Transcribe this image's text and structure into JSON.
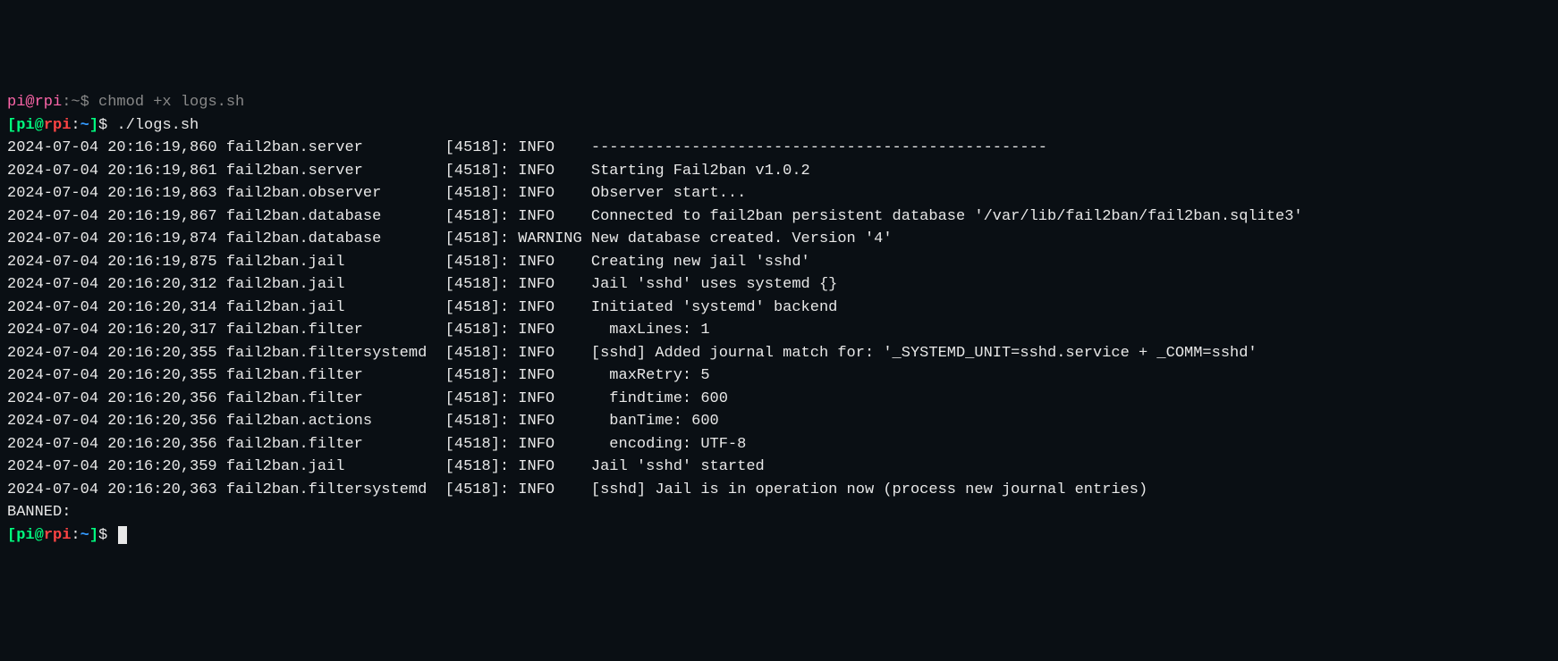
{
  "prompt": {
    "user": "pi",
    "at": "@",
    "host": "rpi",
    "path": "~",
    "dollar": "$",
    "open_bracket": "[",
    "close_bracket": "]",
    "colon": ":"
  },
  "top_partial": {
    "user_fragment": "pi@rpi",
    "rest": ":~$ chmod +x logs.sh"
  },
  "command": "./logs.sh",
  "logs": [
    "2024-07-04 20:16:19,860 fail2ban.server         [4518]: INFO    --------------------------------------------------",
    "2024-07-04 20:16:19,861 fail2ban.server         [4518]: INFO    Starting Fail2ban v1.0.2",
    "2024-07-04 20:16:19,863 fail2ban.observer       [4518]: INFO    Observer start...",
    "2024-07-04 20:16:19,867 fail2ban.database       [4518]: INFO    Connected to fail2ban persistent database '/var/lib/fail2ban/fail2ban.sqlite3'",
    "2024-07-04 20:16:19,874 fail2ban.database       [4518]: WARNING New database created. Version '4'",
    "2024-07-04 20:16:19,875 fail2ban.jail           [4518]: INFO    Creating new jail 'sshd'",
    "2024-07-04 20:16:20,312 fail2ban.jail           [4518]: INFO    Jail 'sshd' uses systemd {}",
    "2024-07-04 20:16:20,314 fail2ban.jail           [4518]: INFO    Initiated 'systemd' backend",
    "2024-07-04 20:16:20,317 fail2ban.filter         [4518]: INFO      maxLines: 1",
    "2024-07-04 20:16:20,355 fail2ban.filtersystemd  [4518]: INFO    [sshd] Added journal match for: '_SYSTEMD_UNIT=sshd.service + _COMM=sshd'",
    "2024-07-04 20:16:20,355 fail2ban.filter         [4518]: INFO      maxRetry: 5",
    "2024-07-04 20:16:20,356 fail2ban.filter         [4518]: INFO      findtime: 600",
    "2024-07-04 20:16:20,356 fail2ban.actions        [4518]: INFO      banTime: 600",
    "2024-07-04 20:16:20,356 fail2ban.filter         [4518]: INFO      encoding: UTF-8",
    "2024-07-04 20:16:20,359 fail2ban.jail           [4518]: INFO    Jail 'sshd' started",
    "2024-07-04 20:16:20,363 fail2ban.filtersystemd  [4518]: INFO    [sshd] Jail is in operation now (process new journal entries)"
  ],
  "banned_label": "BANNED:"
}
